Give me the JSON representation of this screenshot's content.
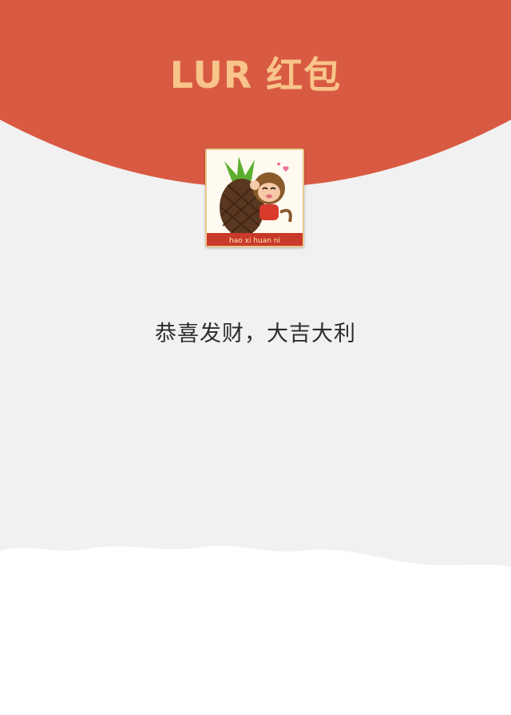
{
  "envelope": {
    "title": "LUR 红包",
    "greeting": "恭喜发财，大吉大利",
    "sticker_caption": "hao xi huan ni"
  },
  "colors": {
    "cap_red": "#d95a42",
    "title_gold": "#f8c48a",
    "paper": "#f1f1f1",
    "torn_white": "#ffffff"
  },
  "icons": {
    "sender_avatar": "monkey-hugging-pineapple-sticker"
  }
}
